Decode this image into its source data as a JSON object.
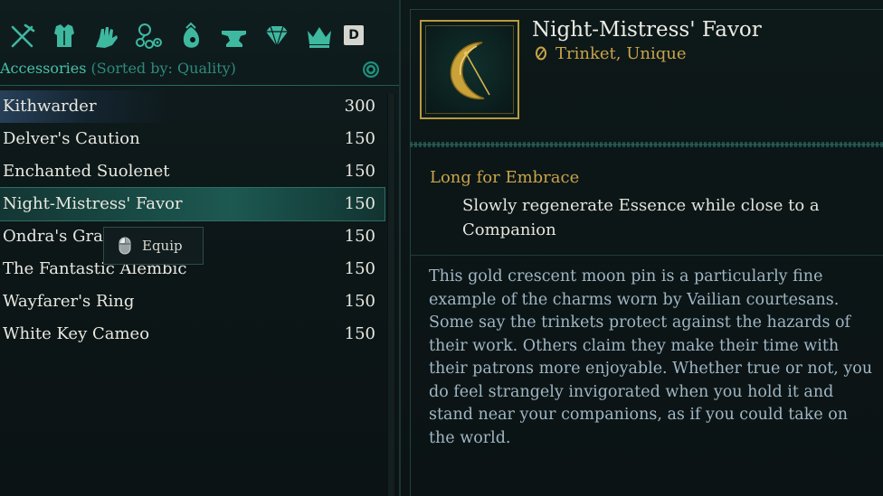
{
  "categories": {
    "icons": [
      "crossed-weapons-icon",
      "chest-armor-icon",
      "gauntlet-icon",
      "necklace-icon",
      "pouch-icon",
      "anvil-icon",
      "gem-icon",
      "crown-icon"
    ],
    "key_hint": "D"
  },
  "header": {
    "title": "Accessories",
    "sorted": "(Sorted by: Quality)"
  },
  "items": [
    {
      "name": "Kithwarder",
      "qty": "300"
    },
    {
      "name": "Delver's Caution",
      "qty": "150"
    },
    {
      "name": "Enchanted Suolenet",
      "qty": "150"
    },
    {
      "name": "Night-Mistress' Favor",
      "qty": "150"
    },
    {
      "name": "Ondra's Grac",
      "qty": "150"
    },
    {
      "name": "The Fantastic Alembic",
      "qty": "150"
    },
    {
      "name": "Wayfarer's Ring",
      "qty": "150"
    },
    {
      "name": "White Key Cameo",
      "qty": "150"
    }
  ],
  "tooltip": {
    "label": "Equip"
  },
  "detail": {
    "title": "Night-Mistress' Favor",
    "subtitle": "Trinket, Unique",
    "ability_name": "Long for Embrace",
    "ability_desc": "Slowly regenerate Essence while close to a Companion",
    "flavor": "This gold crescent moon pin is a particularly fine example of the charms worn by Vailian courtesans. Some say the trinkets protect against the hazards of their work. Others claim they make their time with their patrons more enjoyable. Whether true or not, you do feel strangely invigorated when you hold it and stand near your companions, as if you could take on the world."
  },
  "colors": {
    "teal_accent": "#45c2a6",
    "gold": "#c8a44a",
    "flavor_text": "#9fb6c4",
    "background": "#0c1415"
  }
}
